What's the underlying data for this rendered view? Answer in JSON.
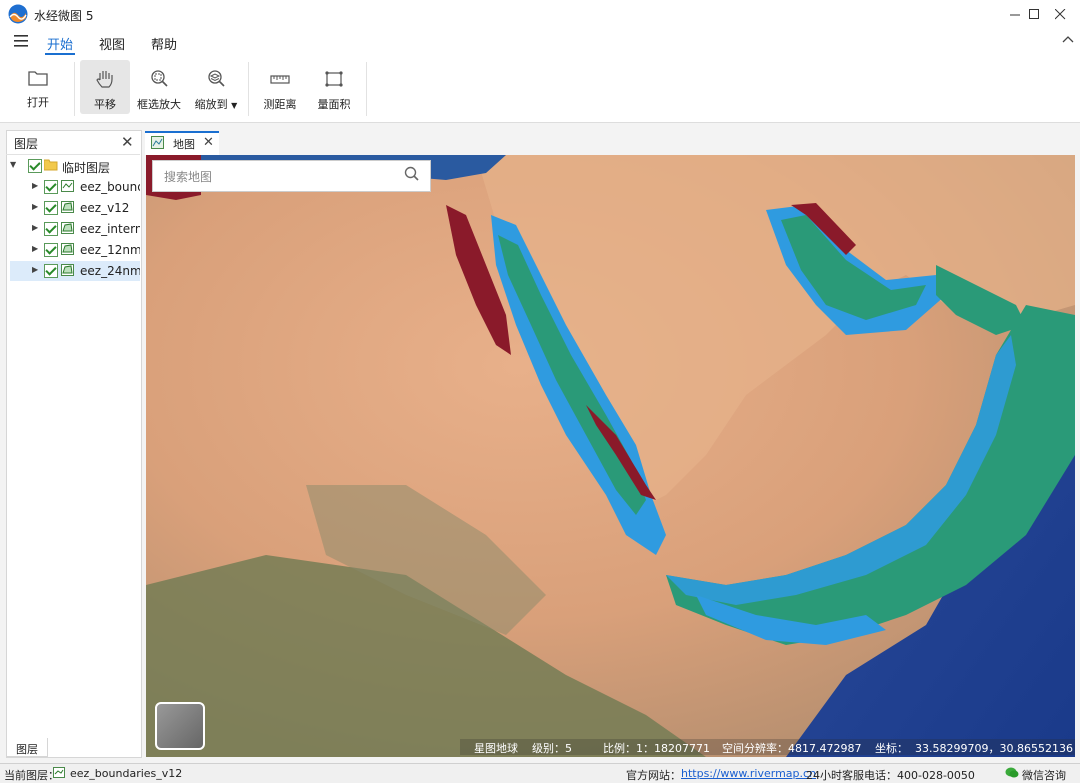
{
  "app": {
    "title": "水经微图 5"
  },
  "menu": {
    "tabs": [
      "开始",
      "视图",
      "帮助"
    ]
  },
  "toolbar": {
    "open": "打开",
    "pan": "平移",
    "zoom_box": "框选放大",
    "zoom_to": "缩放到",
    "measure_distance": "测距离",
    "measure_area": "量面积"
  },
  "layers": {
    "title": "图层",
    "bottom_tab": "图层",
    "group": "临时图层",
    "items": [
      "eez_bound",
      "eez_v12",
      "eez_intern",
      "eez_12nm",
      "eez_24nm"
    ]
  },
  "map": {
    "tab_label": "地图",
    "search_placeholder": "搜索地图",
    "status": {
      "source": "星图地球",
      "level": "级别：5",
      "scale": "比例：1：18207771",
      "resolution": "空间分辨率：4817.472987",
      "coords_label": "坐标：",
      "coords": "33.58299709，30.86552136"
    }
  },
  "statusbar": {
    "current_layer_label": "当前图层：",
    "current_layer": "eez_boundaries_v12",
    "site_label": "官方网站：",
    "site_url": "https://www.rivermap.cn",
    "hotline": "24小时客服电话：400-028-0050",
    "wechat": "微信咨询"
  },
  "colors": {
    "accent": "#1a6fd0",
    "eez_green": "#2a9a78",
    "eez_blue": "#2f9be0",
    "eez_red": "#8a1a2a"
  }
}
